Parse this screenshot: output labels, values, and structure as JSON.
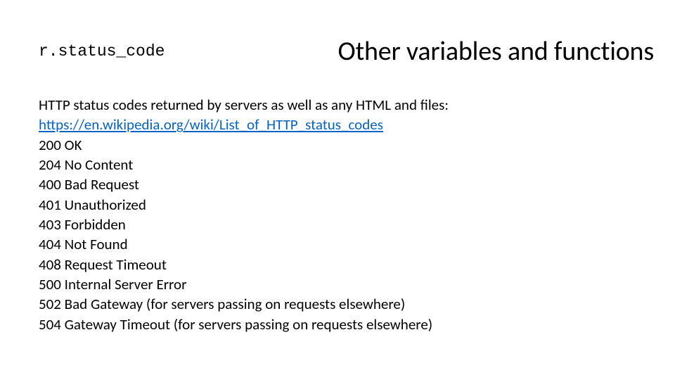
{
  "header": {
    "code_label": "r.status_code",
    "title": "Other variables and functions"
  },
  "content": {
    "intro": "HTTP status codes returned by servers as well as any HTML and files:",
    "link": "https://en.wikipedia.org/wiki/List_of_HTTP_status_codes",
    "statuses": [
      "200 OK",
      "204 No Content",
      "400 Bad Request",
      "401 Unauthorized",
      "403 Forbidden",
      "404 Not Found",
      "408 Request Timeout",
      "500 Internal Server Error",
      "502 Bad Gateway (for servers passing on requests elsewhere)",
      "504 Gateway Timeout (for servers passing on requests elsewhere)"
    ]
  }
}
